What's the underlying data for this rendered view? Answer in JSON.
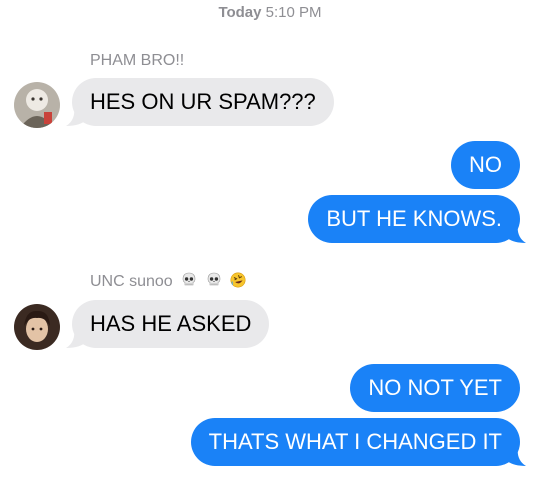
{
  "header": {
    "day": "Today",
    "time": "5:10 PM"
  },
  "colors": {
    "incoming_bubble": "#e9e9eb",
    "outgoing_bubble": "#1a82f7",
    "meta_text": "#8e8e93"
  },
  "groups": [
    {
      "sender": "PHAM BRO!!",
      "sender_emojis": [],
      "messages": [
        "HES ON UR SPAM???"
      ]
    },
    {
      "sender": "me",
      "messages": [
        "NO",
        "BUT HE KNOWS."
      ]
    },
    {
      "sender": "UNC sunoo",
      "sender_emojis": [
        "skull-emoji",
        "skull-emoji",
        "rolling-laughing-emoji"
      ],
      "messages": [
        "HAS HE ASKED"
      ]
    },
    {
      "sender": "me",
      "messages": [
        "NO NOT YET",
        "THATS WHAT I CHANGED IT"
      ]
    }
  ]
}
